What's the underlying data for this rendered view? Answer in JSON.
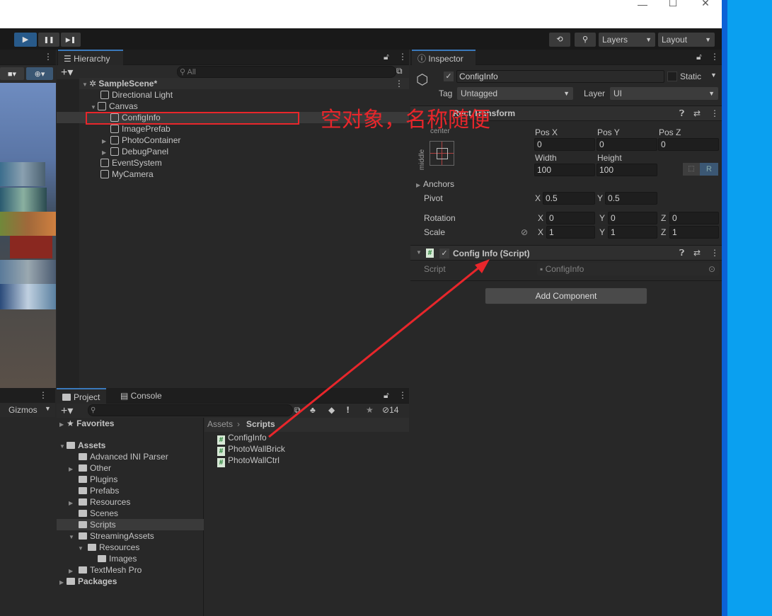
{
  "window": {
    "minimize": "—",
    "maximize": "☐",
    "close": "✕"
  },
  "toolbar": {
    "play": "▶",
    "pause": "❚❚",
    "step": "▶❚",
    "layers": "Layers",
    "layout": "Layout"
  },
  "scene": {
    "gizmos": "Gizmos"
  },
  "hierarchy": {
    "tab": "Hierarchy",
    "search_placeholder": "All",
    "scene": "SampleScene*",
    "items": [
      {
        "label": "Directional Light"
      },
      {
        "label": "Canvas"
      },
      {
        "label": "ConfigInfo"
      },
      {
        "label": "ImagePrefab"
      },
      {
        "label": "PhotoContainer"
      },
      {
        "label": "DebugPanel"
      },
      {
        "label": "EventSystem"
      },
      {
        "label": "MyCamera"
      }
    ]
  },
  "annotation": {
    "text": "空对象，名称随便"
  },
  "inspector": {
    "tab": "Inspector",
    "name": "ConfigInfo",
    "static": "Static",
    "tag_label": "Tag",
    "tag": "Untagged",
    "layer_label": "Layer",
    "layer": "UI",
    "rect": {
      "title": "Rect Transform",
      "h": "center",
      "v": "middle",
      "posx_l": "Pos X",
      "posy_l": "Pos Y",
      "posz_l": "Pos Z",
      "posx": "0",
      "posy": "0",
      "posz": "0",
      "width_l": "Width",
      "height_l": "Height",
      "width": "100",
      "height": "100",
      "r": "R",
      "anchors": "Anchors",
      "pivot": "Pivot",
      "pivot_x": "0.5",
      "pivot_y": "0.5",
      "rotation": "Rotation",
      "rot_x": "0",
      "rot_y": "0",
      "rot_z": "0",
      "scale": "Scale",
      "scale_x": "1",
      "scale_y": "1",
      "scale_z": "1",
      "x": "X",
      "y": "Y",
      "z": "Z"
    },
    "script": {
      "title": "Config Info (Script)",
      "label": "Script",
      "value": "ConfigInfo"
    },
    "add_component": "Add Component"
  },
  "project": {
    "tab_project": "Project",
    "tab_console": "Console",
    "hidden_count": "14",
    "tree": [
      {
        "label": "Favorites"
      },
      {
        "label": "Assets"
      },
      {
        "label": "Advanced INI Parser"
      },
      {
        "label": "Other"
      },
      {
        "label": "Plugins"
      },
      {
        "label": "Prefabs"
      },
      {
        "label": "Resources"
      },
      {
        "label": "Scenes"
      },
      {
        "label": "Scripts"
      },
      {
        "label": "StreamingAssets"
      },
      {
        "label": "Resources"
      },
      {
        "label": "Images"
      },
      {
        "label": "TextMesh Pro"
      },
      {
        "label": "Packages"
      }
    ],
    "breadcrumb": [
      "Assets",
      "Scripts"
    ],
    "files": [
      {
        "label": "ConfigInfo"
      },
      {
        "label": "PhotoWallBrick"
      },
      {
        "label": "PhotoWallCtrl"
      }
    ]
  }
}
